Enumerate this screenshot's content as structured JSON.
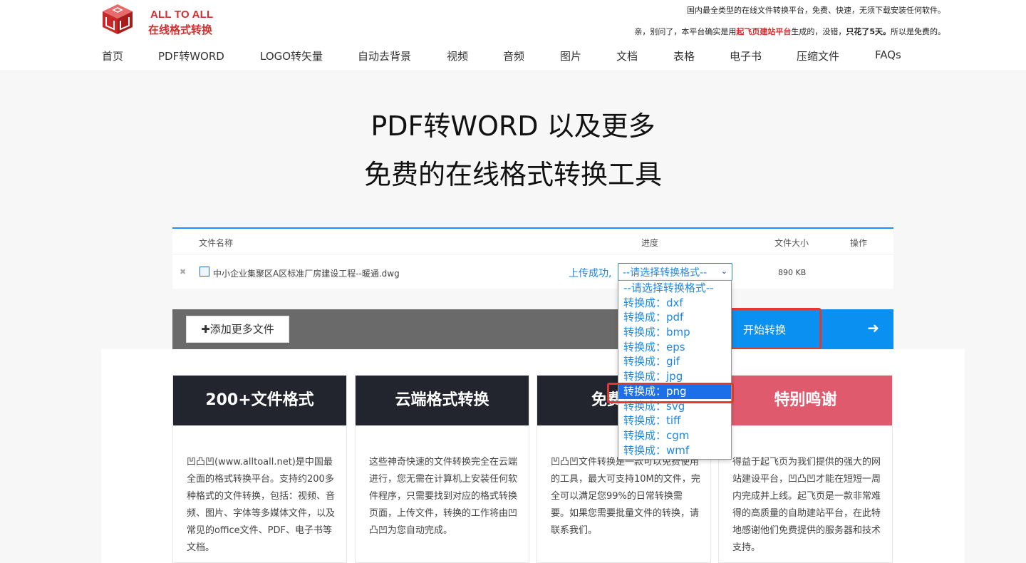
{
  "header": {
    "logo_line1": "ALL TO ALL",
    "logo_line2": "在线格式转换",
    "tagline1": "国内最全类型的在线文件转换平台，免费、快速，无须下载安装任何软件。",
    "tagline2_pre": "亲，别问了，本平台确实是用",
    "tagline2_link": "起飞页建站平台",
    "tagline2_mid": "生成的，没错，",
    "tagline2_bold": "只花了5天。",
    "tagline2_post": "所以是免费的。"
  },
  "nav": [
    "首页",
    "PDF转WORD",
    "LOGO转矢量",
    "自动去背景",
    "视频",
    "音频",
    "图片",
    "文档",
    "表格",
    "电子书",
    "压缩文件",
    "FAQs"
  ],
  "hero": {
    "line1": "PDF转WORD 以及更多",
    "line2": "免费的在线格式转换工具"
  },
  "table": {
    "col_name": "文件名称",
    "col_progress": "进度",
    "col_size": "文件大小",
    "col_action": "操作",
    "remove_glyph": "✖",
    "file_name": "中小企业集聚区A区标准厂房建设工程--暖通.dwg",
    "status": "上传成功,",
    "select_value": "--请选择转换格式--",
    "select_chev": "⌄",
    "file_size": "890 KB"
  },
  "actions": {
    "add_more": "添加更多文件",
    "add_icon": "✚",
    "start": "开始转换",
    "start_arrow": "➜"
  },
  "dropdown": [
    "--请选择转换格式--",
    "转换成：dxf",
    "转换成：pdf",
    "转换成：bmp",
    "转换成：eps",
    "转换成：gif",
    "转换成：jpg",
    "转换成：png",
    "转换成：svg",
    "转换成：tiff",
    "转换成：cgm",
    "转换成：wmf"
  ],
  "dropdown_selected_index": 7,
  "cards": [
    {
      "title": "200+文件格式",
      "body": "凹凸凹(www.alltoall.net)是中国最全面的格式转换平台。支持约200多种格式的文件转换，包括：视频、音频、图片、字体等多媒体文件，以及常见的office文件、PDF、电子书等文档。"
    },
    {
      "title": "云端格式转换",
      "body": "这些神奇快速的文件转换完全在云端进行，您无需在计算机上安装任何软件程序，只需要找到对应的格式转换页面，上传文件，转换的工作将由凹凸凹为您自动完成。"
    },
    {
      "title": "免费",
      "body": "凹凸凹文件转换是一款可以免费使用的工具，最大可支持10M的文件，完全可以满足您99%的日常转换需要。如果您需要批量文件的转换，请联系我们。"
    },
    {
      "title": "特别鸣谢",
      "body": "得益于起飞页为我们提供的强大的网站建设平台，凹凸凹才能在短短一周内完成并上线。起飞页是一款非常难得的高质量的自助建站平台，在此特地感谢他们免费提供的服务器和技术支持。"
    }
  ],
  "colors": {
    "brand_red": "#d42e2e",
    "accent_blue": "#1e88e5",
    "start_blue": "#0a90f0",
    "card_dark": "#23252e",
    "card_pink": "#e05a6e",
    "highlight_red": "#e03a2f"
  }
}
